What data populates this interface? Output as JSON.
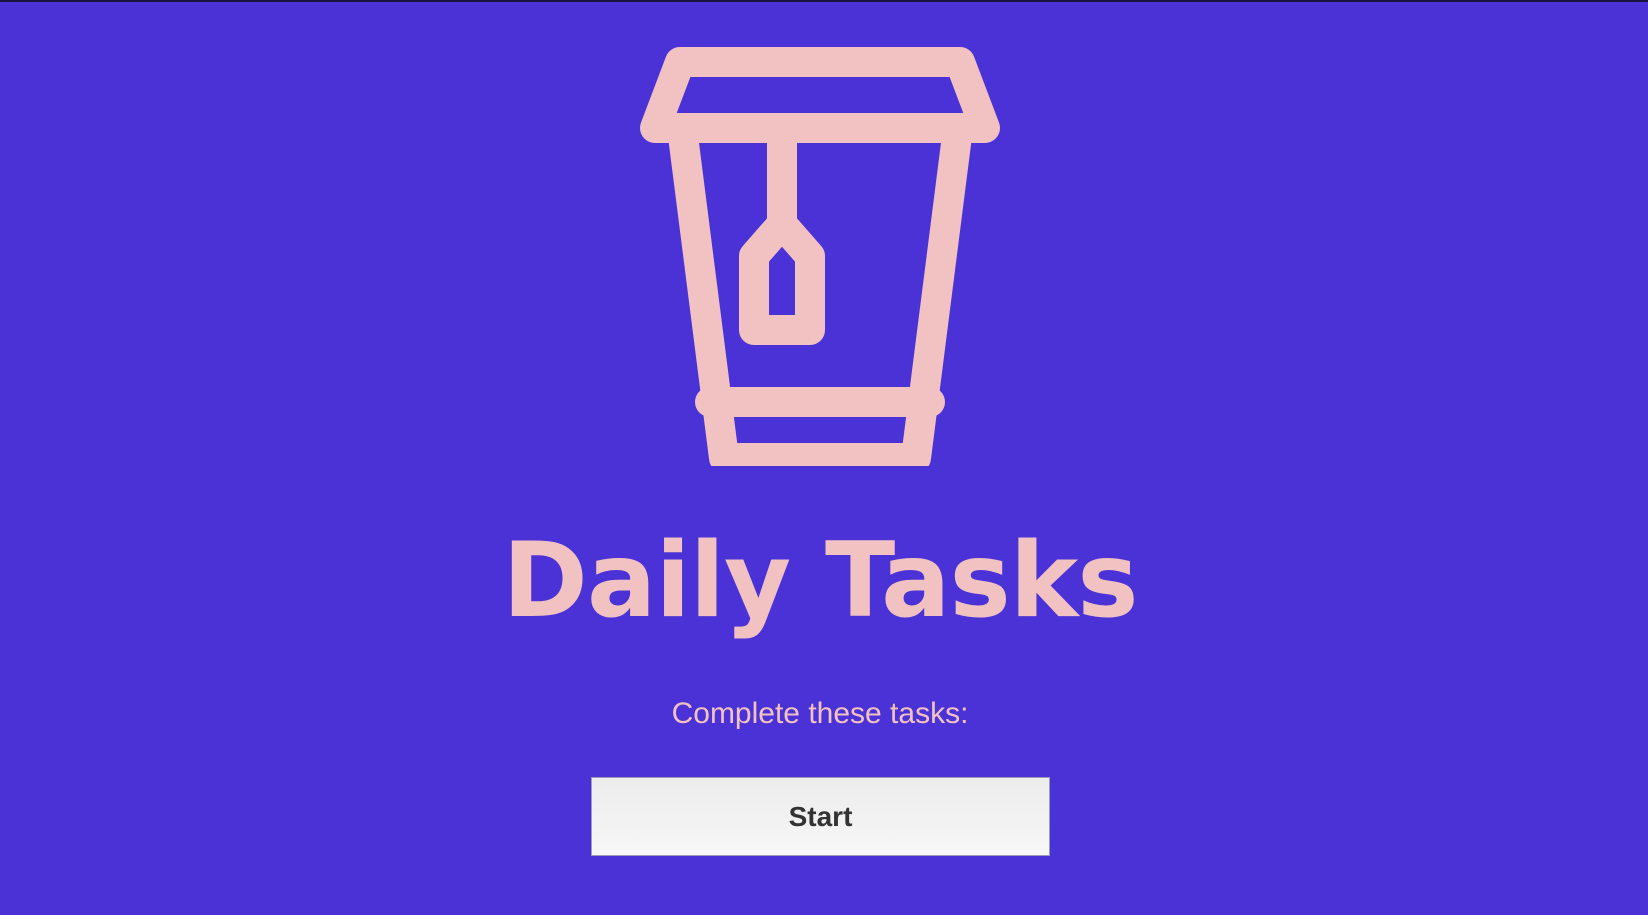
{
  "colors": {
    "background": "#4a32d6",
    "accent": "#f2c1c1",
    "button_background": "#efefef",
    "button_text": "#333333"
  },
  "hero": {
    "icon": "tea-cup-icon",
    "title": "Daily Tasks",
    "subtitle": "Complete these tasks:"
  },
  "actions": {
    "start_label": "Start"
  }
}
